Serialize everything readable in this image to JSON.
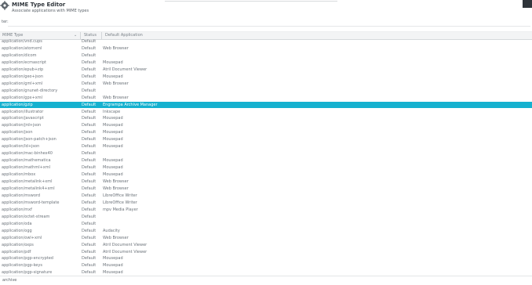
{
  "window": {
    "title": "MIME Type Editor",
    "subtitle": "Associate applications with MIME types",
    "icon": "gear-icon"
  },
  "filter": {
    "label": "ter:"
  },
  "columns": {
    "mime": "MIME Type",
    "status": "Status",
    "app": "Default Application"
  },
  "rows": [
    {
      "mime": "application/vnd.cups",
      "status": "Default",
      "app": ""
    },
    {
      "mime": "application/atomxml",
      "status": "Default",
      "app": "Web Browser"
    },
    {
      "mime": "application/dicom",
      "status": "Default",
      "app": ""
    },
    {
      "mime": "application/ecmascript",
      "status": "Default",
      "app": "Mousepad"
    },
    {
      "mime": "application/epub+zip",
      "status": "Default",
      "app": "Atril Document Viewer"
    },
    {
      "mime": "application/geo+json",
      "status": "Default",
      "app": "Mousepad"
    },
    {
      "mime": "application/gml+xml",
      "status": "Default",
      "app": "Web Browser"
    },
    {
      "mime": "application/gnunet-directory",
      "status": "Default",
      "app": ""
    },
    {
      "mime": "application/gpx+xml",
      "status": "Default",
      "app": "Web Browser"
    },
    {
      "mime": "application/gzip",
      "status": "Default",
      "app": "Engrampa Archive Manager",
      "selected": true
    },
    {
      "mime": "application/illustrator",
      "status": "Default",
      "app": "Inkscape"
    },
    {
      "mime": "application/javascript",
      "status": "Default",
      "app": "Mousepad"
    },
    {
      "mime": "application/jrd+json",
      "status": "Default",
      "app": "Mousepad"
    },
    {
      "mime": "application/json",
      "status": "Default",
      "app": "Mousepad"
    },
    {
      "mime": "application/json-patch+json",
      "status": "Default",
      "app": "Mousepad"
    },
    {
      "mime": "application/ld+json",
      "status": "Default",
      "app": "Mousepad"
    },
    {
      "mime": "application/mac-binhex40",
      "status": "Default",
      "app": ""
    },
    {
      "mime": "application/mathematica",
      "status": "Default",
      "app": "Mousepad"
    },
    {
      "mime": "application/mathml+xml",
      "status": "Default",
      "app": "Mousepad"
    },
    {
      "mime": "application/mbox",
      "status": "Default",
      "app": "Mousepad"
    },
    {
      "mime": "application/metalink+xml",
      "status": "Default",
      "app": "Web Browser"
    },
    {
      "mime": "application/metalink4+xml",
      "status": "Default",
      "app": "Web Browser"
    },
    {
      "mime": "application/msword",
      "status": "Default",
      "app": "LibreOffice Writer"
    },
    {
      "mime": "application/msword-template",
      "status": "Default",
      "app": "LibreOffice Writer"
    },
    {
      "mime": "application/mxf",
      "status": "Default",
      "app": "mpv Media Player"
    },
    {
      "mime": "application/octet-stream",
      "status": "Default",
      "app": ""
    },
    {
      "mime": "application/oda",
      "status": "Default",
      "app": ""
    },
    {
      "mime": "application/ogg",
      "status": "Default",
      "app": "Audacity"
    },
    {
      "mime": "application/owl+xml",
      "status": "Default",
      "app": "Web Browser"
    },
    {
      "mime": "application/oxps",
      "status": "Default",
      "app": "Atril Document Viewer"
    },
    {
      "mime": "application/pdf",
      "status": "Default",
      "app": "Atril Document Viewer"
    },
    {
      "mime": "application/pgp-encrypted",
      "status": "Default",
      "app": "Mousepad"
    },
    {
      "mime": "application/pgp-keys",
      "status": "Default",
      "app": "Mousepad"
    },
    {
      "mime": "application/pgp-signature",
      "status": "Default",
      "app": "Mousepad"
    }
  ],
  "statusbar": {
    "text": "archive"
  }
}
